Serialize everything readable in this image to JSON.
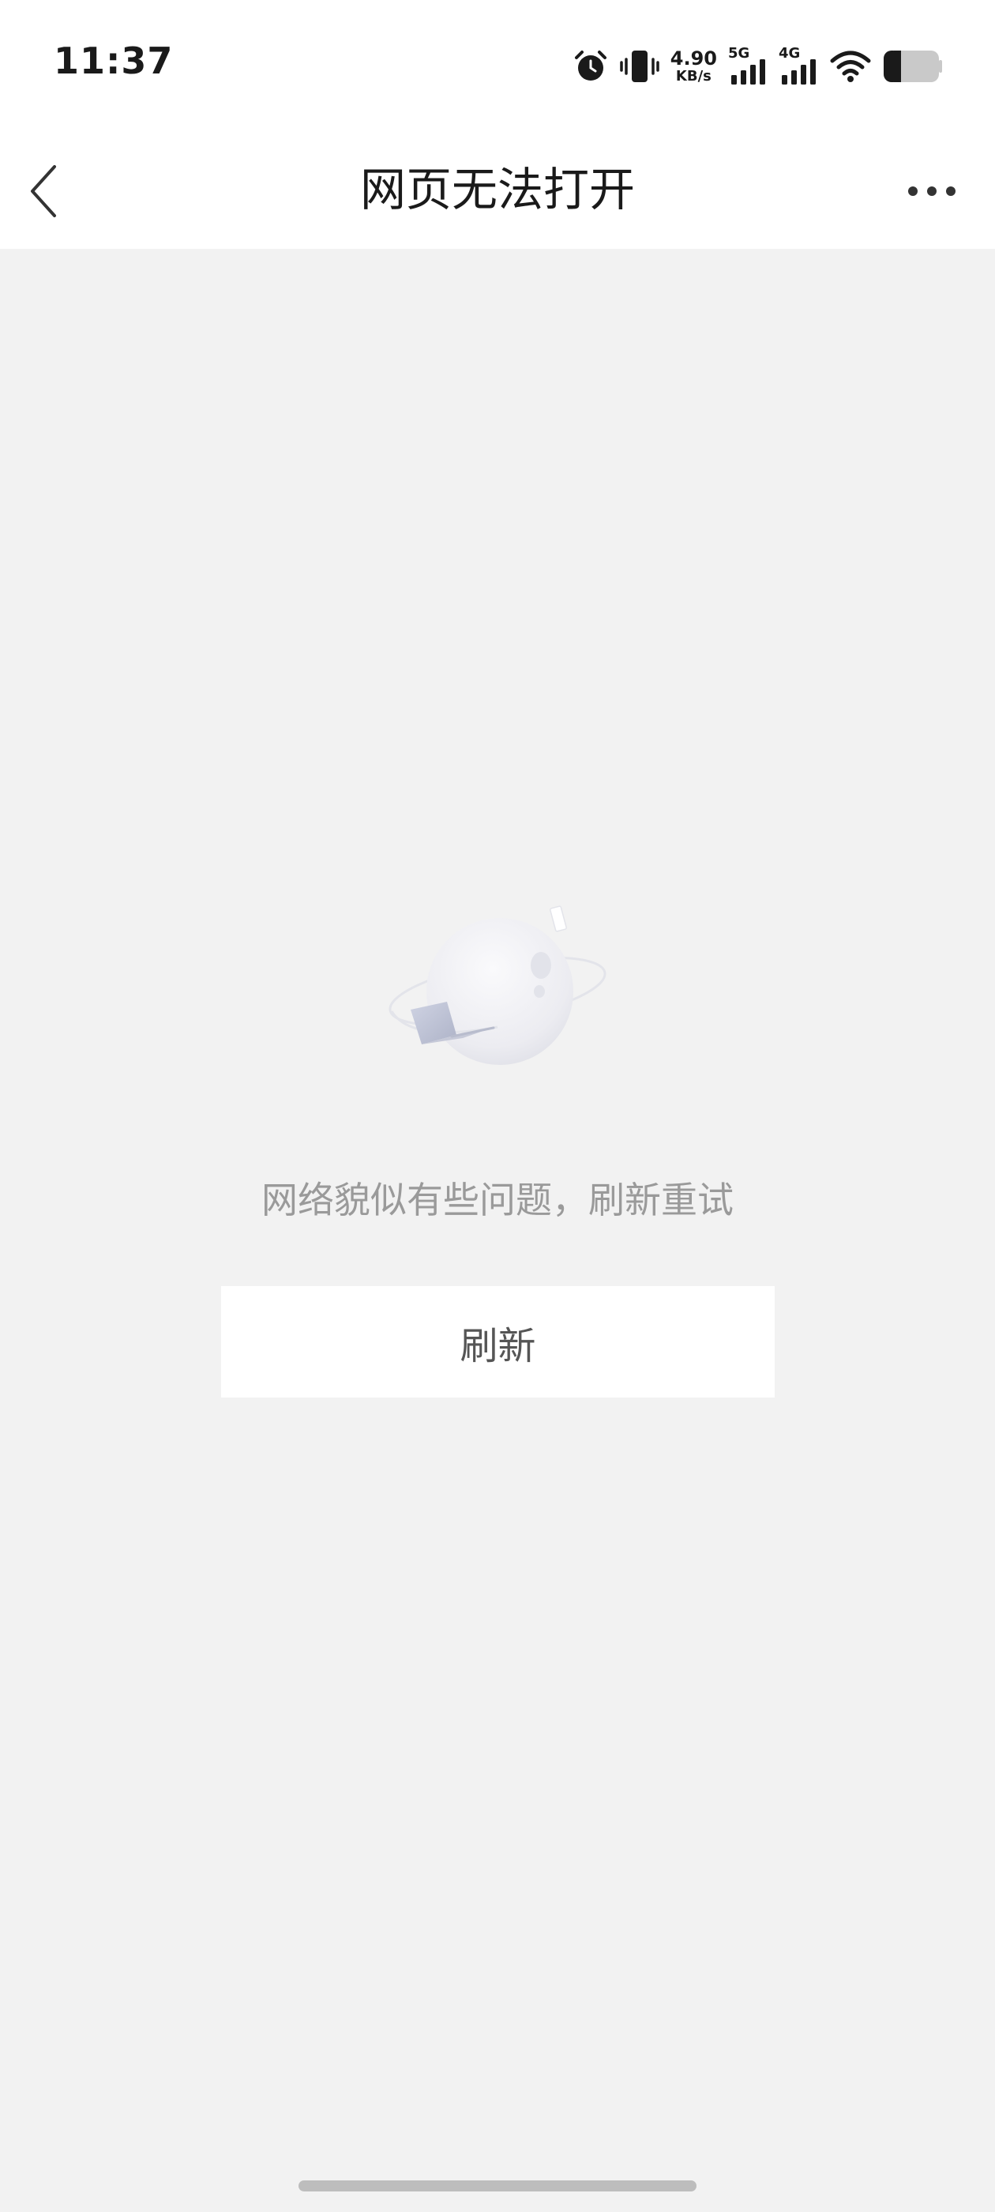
{
  "status_bar": {
    "time": "11:37",
    "net_speed_value": "4.90",
    "net_speed_unit": "KB/s",
    "signal1_label": "5G",
    "signal2_label": "4G",
    "icons": [
      "alarm-icon",
      "vibrate-icon",
      "signal-5g-icon",
      "signal-4g-icon",
      "wifi-icon",
      "battery-icon"
    ],
    "battery_level": 0.3
  },
  "nav": {
    "title": "网页无法打开",
    "back_icon": "chevron-left-icon",
    "more_icon": "more-dots-icon"
  },
  "content": {
    "illustration": "planet-laptop-illustration",
    "message": "网络貌似有些问题，刷新重试",
    "refresh_label": "刷新"
  },
  "colors": {
    "background": "#f2f2f2",
    "surface": "#ffffff",
    "title_text": "#1a1a1a",
    "message_text": "#9a9a9a",
    "button_text": "#555555"
  }
}
